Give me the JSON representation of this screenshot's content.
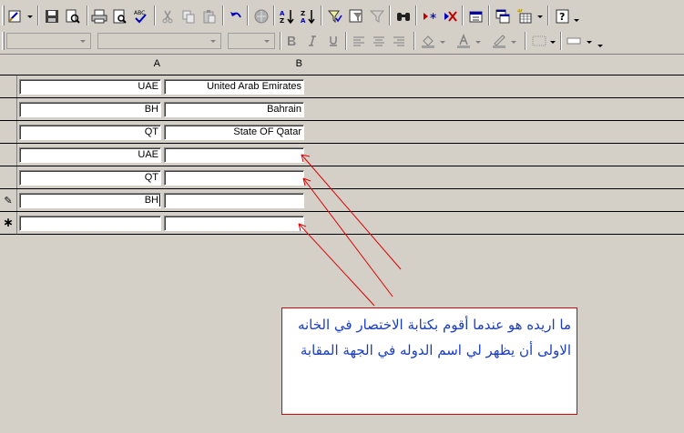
{
  "icons": {
    "accent": "#0000ff",
    "error_red": "#e00000",
    "toolbar_gray": "#808080"
  },
  "datasheet": {
    "columns": [
      "A",
      "B"
    ],
    "rows": [
      {
        "a": "UAE",
        "b": "United Arab Emirates"
      },
      {
        "a": "BH",
        "b": "Bahrain"
      },
      {
        "a": "QT",
        "b": "State OF Qatar"
      },
      {
        "a": "UAE",
        "b": ""
      },
      {
        "a": "QT",
        "b": ""
      },
      {
        "a": "BH",
        "b": ""
      }
    ],
    "editing_glyph": "✎",
    "new_record_glyph": "∗"
  },
  "annotation": {
    "text": "ما اريده هو عندما أقوم بكتابة الاختصار في الخانه الاولى أن يظهر لي اسم الدوله في الجهة المقابة",
    "color": "#1a3dc0",
    "arrow_color": "#e00000"
  }
}
